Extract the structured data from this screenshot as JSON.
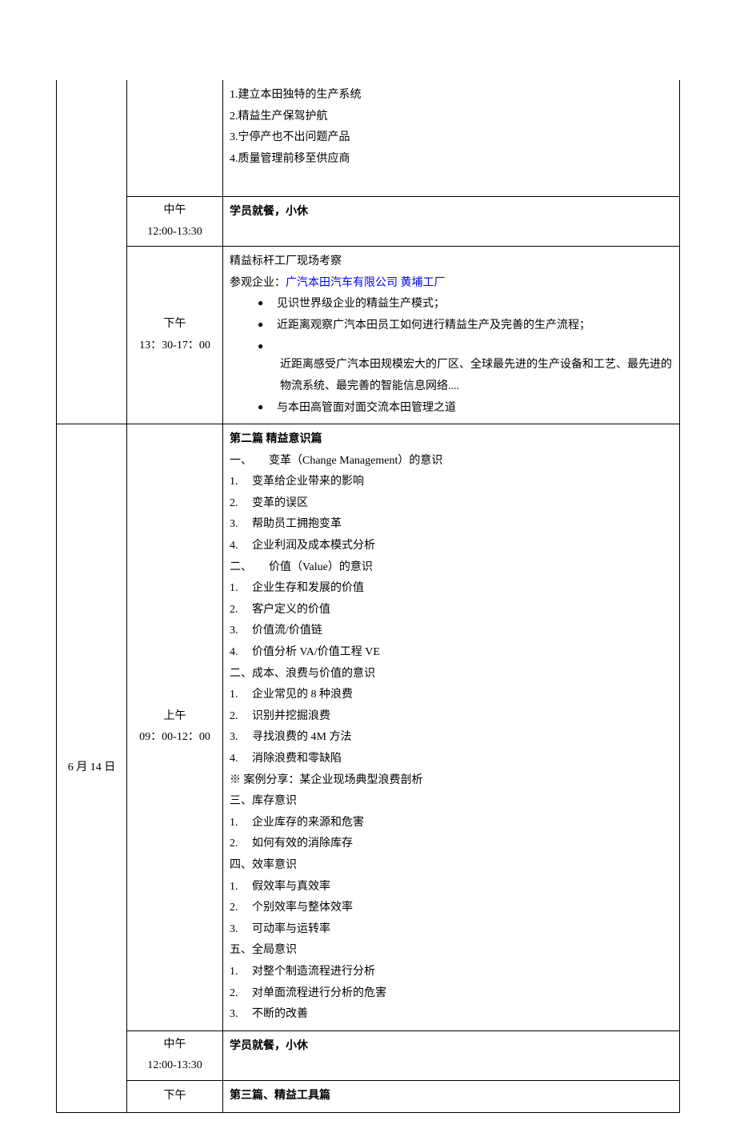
{
  "rows": [
    {
      "date": "",
      "time_label": "",
      "time_range": "",
      "content_type": "r1",
      "r1": {
        "l1": "1.建立本田独特的生产系统",
        "l2": "2.精益生产保驾护航",
        "l3": "3.宁停产也不出问题产品",
        "l4": "4.质量管理前移至供应商"
      }
    },
    {
      "time_label": "中午",
      "time_range": "12:00-13:30",
      "content_type": "lunch",
      "lunch_text": "学员就餐，小休"
    },
    {
      "time_label": "下午",
      "time_range": "13：30-17：00",
      "content_type": "r3",
      "r3": {
        "l1": "精益标杆工厂现场考察",
        "l2a": "参观企业：",
        "l2b": "广汽本田汽车有限公司 黄埔工厂",
        "b1": "见识世界级企业的精益生产模式；",
        "b2": "近距离观察广汽本田员工如何进行精益生产及完善的生产流程；",
        "b3": "近距离感受广汽本田规模宏大的厂区、全球最先进的生产设备和工艺、最先进的物流系统、最完善的智能信息网络....",
        "b4": "与本田高管面对面交流本田管理之道"
      }
    },
    {
      "date": "6 月 14 日",
      "time_label": "上午",
      "time_range": "09：00-12：00",
      "content_type": "r4",
      "r4": {
        "h1": "第二篇 精益意识篇",
        "s1": "一、　　变革（Change Management）的意识",
        "s1_1": "1.　 变革给企业带来的影响",
        "s1_2": "2.　 变革的误区",
        "s1_3": "3.　 帮助员工拥抱变革",
        "s1_4": "4.　 企业利润及成本模式分析",
        "s2": "二、　　价值（Value）的意识",
        "s2_1": "1.　 企业生存和发展的价值",
        "s2_2": "2.　 客户定义的价值",
        "s2_3": "3.　 价值流/价值链",
        "s2_4": "4.　 价值分析 VA/价值工程 VE",
        "s3": "二、成本、浪费与价值的意识",
        "s3_1": "1.　 企业常见的 8 种浪费",
        "s3_2": "2.　 识别并挖掘浪费",
        "s3_3": "3.　 寻找浪费的 4M 方法",
        "s3_4": "4.　 消除浪费和零缺陷",
        "s3_5": "※ 案例分享：某企业现场典型浪费剖析",
        "s4": "三、库存意识",
        "s4_1": "1.　 企业库存的来源和危害",
        "s4_2": "2.　 如何有效的消除库存",
        "s5": "四、效率意识",
        "s5_1": "1.　 假效率与真效率",
        "s5_2": "2.　 个别效率与整体效率",
        "s5_3": "3.　 可动率与运转率",
        "s6": "五、全局意识",
        "s6_1": "1.　 对整个制造流程进行分析",
        "s6_2": "2.　 对单面流程进行分析的危害",
        "s6_3": "3.　 不断的改善"
      }
    },
    {
      "time_label": "中午",
      "time_range": "12:00-13:30",
      "content_type": "lunch",
      "lunch_text": "学员就餐，小休"
    },
    {
      "time_label": "下午",
      "time_range": "",
      "content_type": "r6",
      "r6_text": "第三篇、精益工具篇"
    }
  ]
}
